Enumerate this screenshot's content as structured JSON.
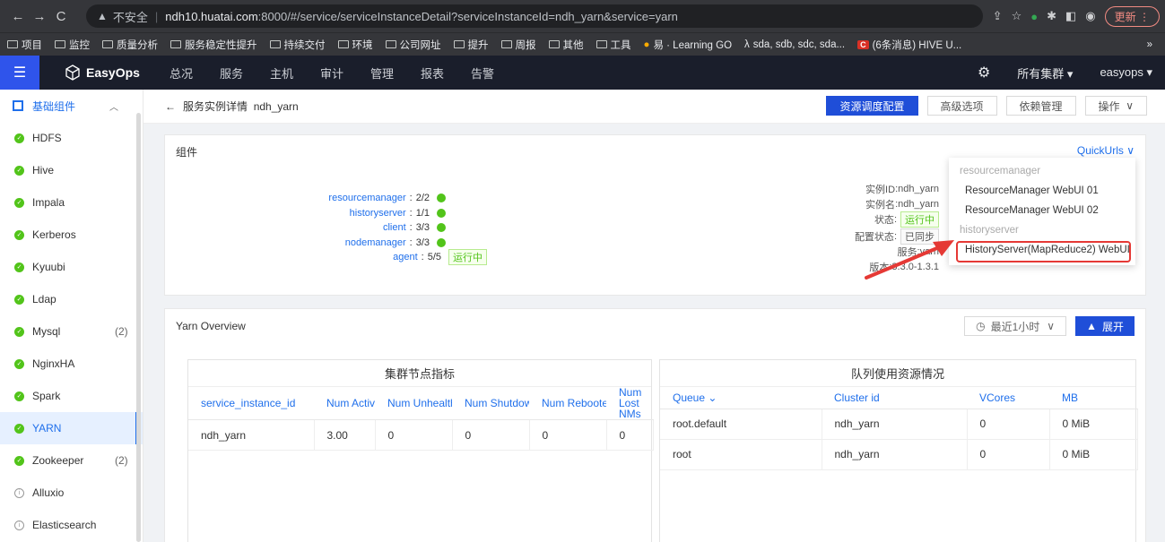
{
  "browser": {
    "insecure_label": "不安全",
    "url_host": "ndh10.huatai.com",
    "url_rest": ":8000/#/service/serviceInstanceDetail?serviceInstanceId=ndh_yarn&service=yarn",
    "update_label": "更新"
  },
  "bookmarks": [
    "项目",
    "监控",
    "质量分析",
    "服务稳定性提升",
    "持续交付",
    "环境",
    "公司网址",
    "提升",
    "周报",
    "其他",
    "工具"
  ],
  "bookmarks_extra": {
    "learning": "易 · Learning GO",
    "disks": "sda, sdb, sdc, sda...",
    "hive": "(6条消息) HIVE U...",
    "more": "»"
  },
  "header": {
    "logo": "EasyOps",
    "nav": [
      "总况",
      "服务",
      "主机",
      "审计",
      "管理",
      "报表",
      "告警"
    ],
    "cluster": "所有集群",
    "user": "easyops"
  },
  "sidebar": {
    "group": "基础组件",
    "items": [
      {
        "label": "HDFS",
        "count": "",
        "status": "ok"
      },
      {
        "label": "Hive",
        "count": "",
        "status": "ok"
      },
      {
        "label": "Impala",
        "count": "",
        "status": "ok"
      },
      {
        "label": "Kerberos",
        "count": "",
        "status": "ok"
      },
      {
        "label": "Kyuubi",
        "count": "",
        "status": "ok"
      },
      {
        "label": "Ldap",
        "count": "",
        "status": "ok"
      },
      {
        "label": "Mysql",
        "count": "(2)",
        "status": "ok"
      },
      {
        "label": "NginxHA",
        "count": "",
        "status": "ok"
      },
      {
        "label": "Spark",
        "count": "",
        "status": "ok"
      },
      {
        "label": "YARN",
        "count": "",
        "status": "ok"
      },
      {
        "label": "Zookeeper",
        "count": "(2)",
        "status": "ok"
      },
      {
        "label": "Alluxio",
        "count": "",
        "status": "none"
      },
      {
        "label": "Elasticsearch",
        "count": "",
        "status": "none"
      }
    ]
  },
  "page": {
    "back": "←",
    "title": "服务实例详情",
    "instance": "ndh_yarn",
    "buttons": {
      "schedule": "资源调度配置",
      "advanced": "高级选项",
      "deps": "依赖管理",
      "ops": "操作"
    }
  },
  "components": {
    "title": "组件",
    "quickurls": "QuickUrls",
    "rows": [
      {
        "name": "resourcemanager",
        "value": "2/2"
      },
      {
        "name": "historyserver",
        "value": "1/1"
      },
      {
        "name": "client",
        "value": "3/3"
      },
      {
        "name": "nodemanager",
        "value": "3/3"
      },
      {
        "name": "agent",
        "value": "5/5"
      }
    ],
    "running": "运行中",
    "info": {
      "id_label": "实例ID",
      "id": "ndh_yarn",
      "name_label": "实例名",
      "name": "ndh_yarn",
      "status_label": "状态",
      "status": "运行中",
      "config_label": "配置状态",
      "config": "已同步",
      "service_label": "服务",
      "service": "yarn",
      "version_label": "版本",
      "version": "3.3.0-1.3.1"
    }
  },
  "quickurls_menu": {
    "group1": "resourcemanager",
    "item1": "ResourceManager WebUI 01",
    "item2": "ResourceManager WebUI 02",
    "group2": "historyserver",
    "item3": "HistoryServer(MapReduce2) WebUI"
  },
  "overview": {
    "title": "Yarn Overview",
    "time_select": "最近1小时",
    "expand": "展开",
    "left": {
      "title": "集群节点指标",
      "columns": [
        "service_instance_id",
        "Num ActiveNMs",
        "Num UnhealthyNMs",
        "Num ShutdownNMs",
        "Num RebootedNMs",
        "Num Lost NMs"
      ],
      "rows": [
        [
          "ndh_yarn",
          "3.00",
          "0",
          "0",
          "0",
          "0"
        ]
      ]
    },
    "right": {
      "title": "队列使用资源情况",
      "columns": [
        "Queue",
        "Cluster id",
        "VCores",
        "MB"
      ],
      "rows": [
        [
          "root.default",
          "ndh_yarn",
          "0",
          "0 MiB"
        ],
        [
          "root",
          "ndh_yarn",
          "0",
          "0 MiB"
        ]
      ]
    }
  },
  "colors": {
    "primary": "#1f4ed8",
    "link": "#1f6feb",
    "ok": "#52c41a",
    "highlight": "#e53935"
  }
}
